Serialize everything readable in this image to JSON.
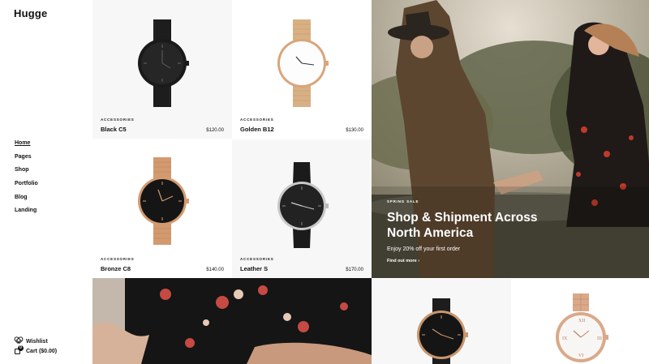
{
  "brand": {
    "logo": "Hugge"
  },
  "nav": {
    "items": [
      {
        "label": "Home",
        "active": true
      },
      {
        "label": "Pages",
        "active": false
      },
      {
        "label": "Shop",
        "active": false
      },
      {
        "label": "Portfolio",
        "active": false
      },
      {
        "label": "Blog",
        "active": false
      },
      {
        "label": "Landing",
        "active": false
      }
    ]
  },
  "footer": {
    "wishlist": "Wishlist",
    "cart": "Cart ($0.00)",
    "cart_count": "0"
  },
  "products": [
    {
      "category": "ACCESSORIES",
      "name": "Black C5",
      "price": "$120.00"
    },
    {
      "category": "ACCESSORIES",
      "name": "Golden B12",
      "price": "$130.00"
    },
    {
      "category": "ACCESSORIES",
      "name": "Bronze C8",
      "price": "$140.00"
    },
    {
      "category": "ACCESSORIES",
      "name": "Leather S",
      "price": "$170.00"
    }
  ],
  "hero": {
    "tag": "SPRING SALE",
    "headline": "Shop & Shipment Across North America",
    "subtext": "Enjoy 20% off your first order",
    "link": "Find out more ›"
  },
  "colors": {
    "text": "#111111",
    "cell_bg": "#f7f7f7",
    "rose_gold": "#c8956c",
    "black": "#1a1a1a"
  }
}
